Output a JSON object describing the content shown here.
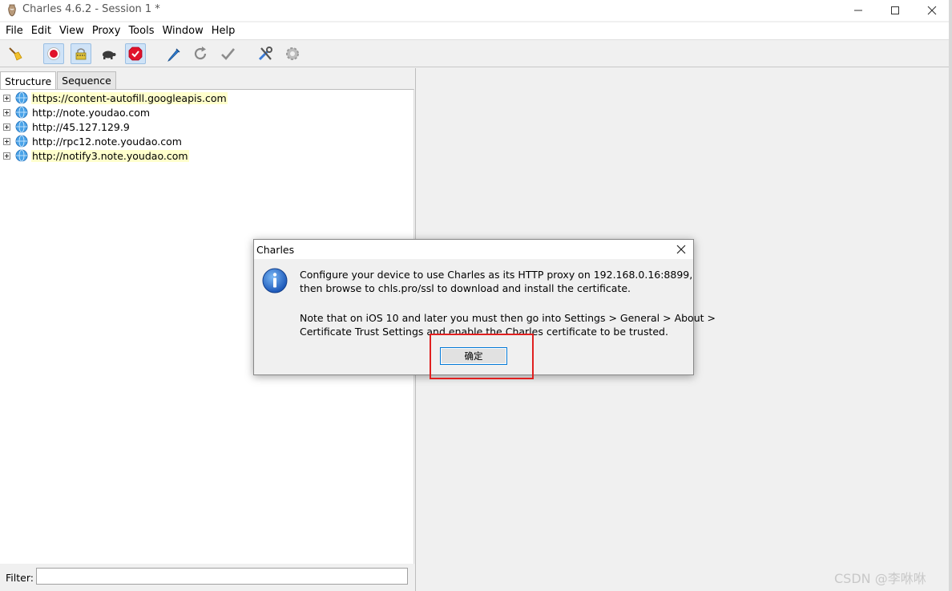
{
  "window": {
    "title": "Charles 4.6.2 - Session 1 *"
  },
  "menu": [
    "File",
    "Edit",
    "View",
    "Proxy",
    "Tools",
    "Window",
    "Help"
  ],
  "toolbar": {
    "items": [
      {
        "icon": "broom-icon",
        "active": false
      },
      {
        "icon": "record-icon",
        "active": true
      },
      {
        "icon": "throttle-icon",
        "active": true
      },
      {
        "icon": "turtle-icon",
        "active": false
      },
      {
        "icon": "breakpoint-check-icon",
        "active": true
      },
      {
        "icon": "pen-icon",
        "active": false
      },
      {
        "icon": "refresh-icon",
        "active": false
      },
      {
        "icon": "checkmark-icon",
        "active": false
      },
      {
        "icon": "tools-icon",
        "active": false
      },
      {
        "icon": "gear-icon",
        "active": false
      }
    ]
  },
  "tabs": [
    "Structure",
    "Sequence"
  ],
  "tree": [
    {
      "host": "https://content-autofill.googleapis.com",
      "highlighted": true
    },
    {
      "host": "http://note.youdao.com",
      "highlighted": false
    },
    {
      "host": "http://45.127.129.9",
      "highlighted": false
    },
    {
      "host": "http://rpc12.note.youdao.com",
      "highlighted": false
    },
    {
      "host": "http://notify3.note.youdao.com",
      "highlighted": true
    }
  ],
  "filter": {
    "label": "Filter:",
    "value": ""
  },
  "dialog": {
    "title": "Charles",
    "lines": [
      "Configure your device to use Charles as its HTTP proxy on 192.168.0.16:8899,",
      "then browse to chls.pro/ssl to download and install the certificate.",
      "Note that on iOS 10 and later you must then go into Settings > General > About >",
      "Certificate Trust Settings and enable the Charles certificate to be trusted."
    ],
    "ok_label": "确定"
  },
  "watermark": "CSDN @李咻咻",
  "colors": {
    "highlight_box": "#e02020",
    "tree_highlight": "#ffffcc",
    "focus_border": "#0078d7"
  }
}
